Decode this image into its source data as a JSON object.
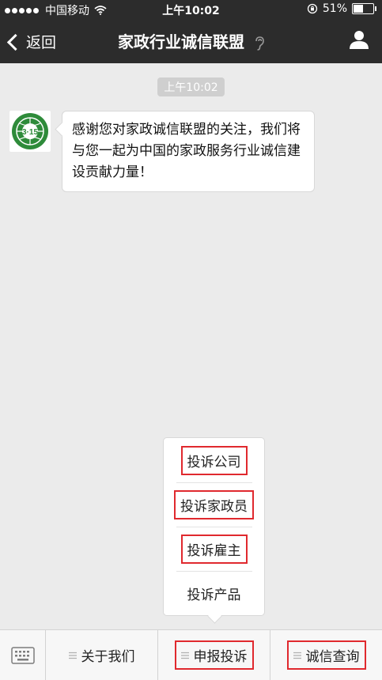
{
  "status_bar": {
    "carrier": "中国移动",
    "time": "上午10:02",
    "battery_percent": "51%",
    "battery_level": 0.51
  },
  "nav": {
    "back_label": "返回",
    "title": "家政行业诚信联盟"
  },
  "chat": {
    "timestamp": "上午10:02",
    "avatar_text": "3·15",
    "message": "感谢您对家政诚信联盟的关注，我们将与您一起为中国的家政服务行业诚信建设贡献力量！"
  },
  "popup_menu": {
    "items": [
      {
        "label": "投诉公司",
        "highlighted": true
      },
      {
        "label": "投诉家政员",
        "highlighted": true
      },
      {
        "label": "投诉雇主",
        "highlighted": true
      },
      {
        "label": "投诉产品",
        "highlighted": false
      }
    ]
  },
  "bottom_menu": {
    "items": [
      {
        "label": "关于我们",
        "highlighted": false
      },
      {
        "label": "申报投诉",
        "highlighted": true
      },
      {
        "label": "诚信查询",
        "highlighted": true
      }
    ]
  },
  "colors": {
    "bar_bg": "#2c2c2c",
    "chat_bg": "#ebebeb",
    "highlight": "#e0292e",
    "logo_green": "#2e8b3a"
  },
  "icons": [
    "wifi-icon",
    "orientation-lock-icon",
    "battery-icon",
    "back-chevron-icon",
    "ear-icon",
    "profile-icon",
    "keyboard-icon",
    "menu-lines-icon"
  ]
}
